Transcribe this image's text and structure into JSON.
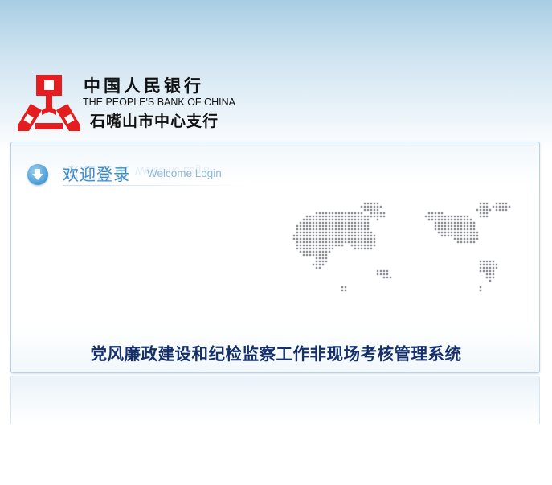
{
  "bank": {
    "name_cn": "中国人民银行",
    "name_en": "THE PEOPLE'S BANK OF CHINA",
    "branch": "石嘴山市中心支行",
    "logo_icon": "pboc-logo-icon",
    "logo_color": "#e41e20"
  },
  "login": {
    "welcome_cn": "欢迎登录",
    "welcome_en": "Welcome Login",
    "welcome_icon": "down-arrow-circle-icon",
    "map_icon": "dotted-world-map-icon"
  },
  "system": {
    "title": "党风廉政建设和纪检监察工作非现场考核管理系统",
    "title_color": "#152f6a"
  },
  "colors": {
    "accent": "#3d8cc8",
    "sky": "#a8cde3",
    "panel_border": "#b7d2e6"
  }
}
